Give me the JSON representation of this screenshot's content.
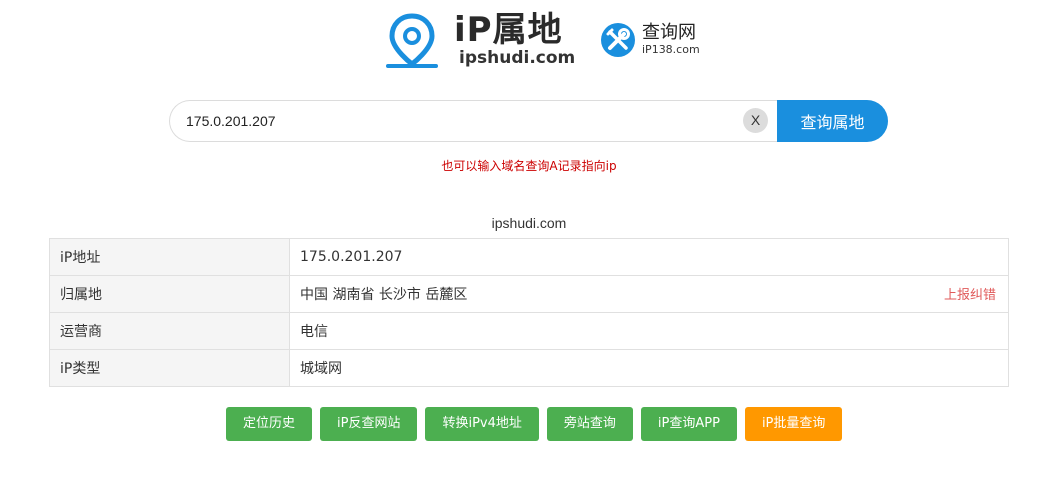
{
  "header": {
    "brand": "iP属地",
    "domain": "ipshudi.com",
    "partner_name": "查询网",
    "partner_domain": "iP138.com",
    "colors": {
      "pin_icon": "#1a8fde",
      "tool_icon": "#1a8fde"
    }
  },
  "search": {
    "value": "175.0.201.207",
    "clear_label": "X",
    "button_label": "查询属地",
    "hint": "也可以输入域名查询A记录指向ip",
    "colors": {
      "button": "#1a8fde",
      "hint": "#cc0000"
    }
  },
  "result": {
    "caption": "ipshudi.com",
    "rows": [
      {
        "key": "iP地址",
        "value": "175.0.201.207"
      },
      {
        "key": "归属地",
        "value": "中国 湖南省 长沙市 岳麓区",
        "action": "上报纠错"
      },
      {
        "key": "运营商",
        "value": "电信"
      },
      {
        "key": "iP类型",
        "value": "城域网"
      }
    ]
  },
  "actions": [
    {
      "label": "定位历史",
      "color": "#4caf50"
    },
    {
      "label": "iP反查网站",
      "color": "#4caf50"
    },
    {
      "label": "转换iPv4地址",
      "color": "#4caf50"
    },
    {
      "label": "旁站查询",
      "color": "#4caf50"
    },
    {
      "label": "iP查询APP",
      "color": "#4caf50"
    },
    {
      "label": "iP批量查询",
      "color": "#ff9800"
    }
  ]
}
